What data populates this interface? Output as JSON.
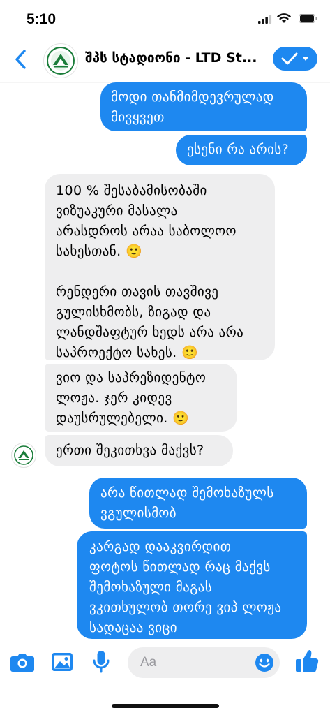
{
  "status": {
    "time": "5:10"
  },
  "header": {
    "title": "შპს სტადიონი - LTD St..."
  },
  "messages": [
    {
      "dir": "out",
      "text": "მოდი თანმიმდევრულად\nმივყვეთ"
    },
    {
      "dir": "out",
      "text": "ესენი რა არის?"
    },
    {
      "dir": "in",
      "text": "100 % შესაბამისობაში\nვიზუაკური მასალა\nარასდროს არაა საბოლოო\nსახესთან. 🙂\n\nრენდერი თავის თავშივე\nგულისხმობს, ზიგად და\nლანდშაფტურ ხედს არა არა\nსაპროექტო სახეს. 🙂"
    },
    {
      "dir": "in",
      "text": "ვიო და საპრეზიდენტო\nლოჟა. ჯერ კიდევ\nდაუსრულებელი. 🙂"
    },
    {
      "dir": "in",
      "text": "ერთი შეკითხვა მაქვს?"
    },
    {
      "dir": "out",
      "text": "არა წითლად შემოხაზულს\nვგულისმობ"
    },
    {
      "dir": "out",
      "text": "კარგად დააკვირდით\nფოტოს წითლად რაც მაქვს\nშემოხაზული მაგას\nვკითხულობ თორე ვიპ ლოჟა\nსადაცაა ვიცი"
    }
  ],
  "composer": {
    "placeholder": "Aa"
  },
  "icons": [
    "back-icon",
    "checkmark-icon",
    "camera-icon",
    "photo-icon",
    "microphone-icon",
    "emoji-icon",
    "thumbs-up-icon"
  ],
  "colors": {
    "accent": "#1e88f0",
    "incoming": "#eeeeef"
  }
}
